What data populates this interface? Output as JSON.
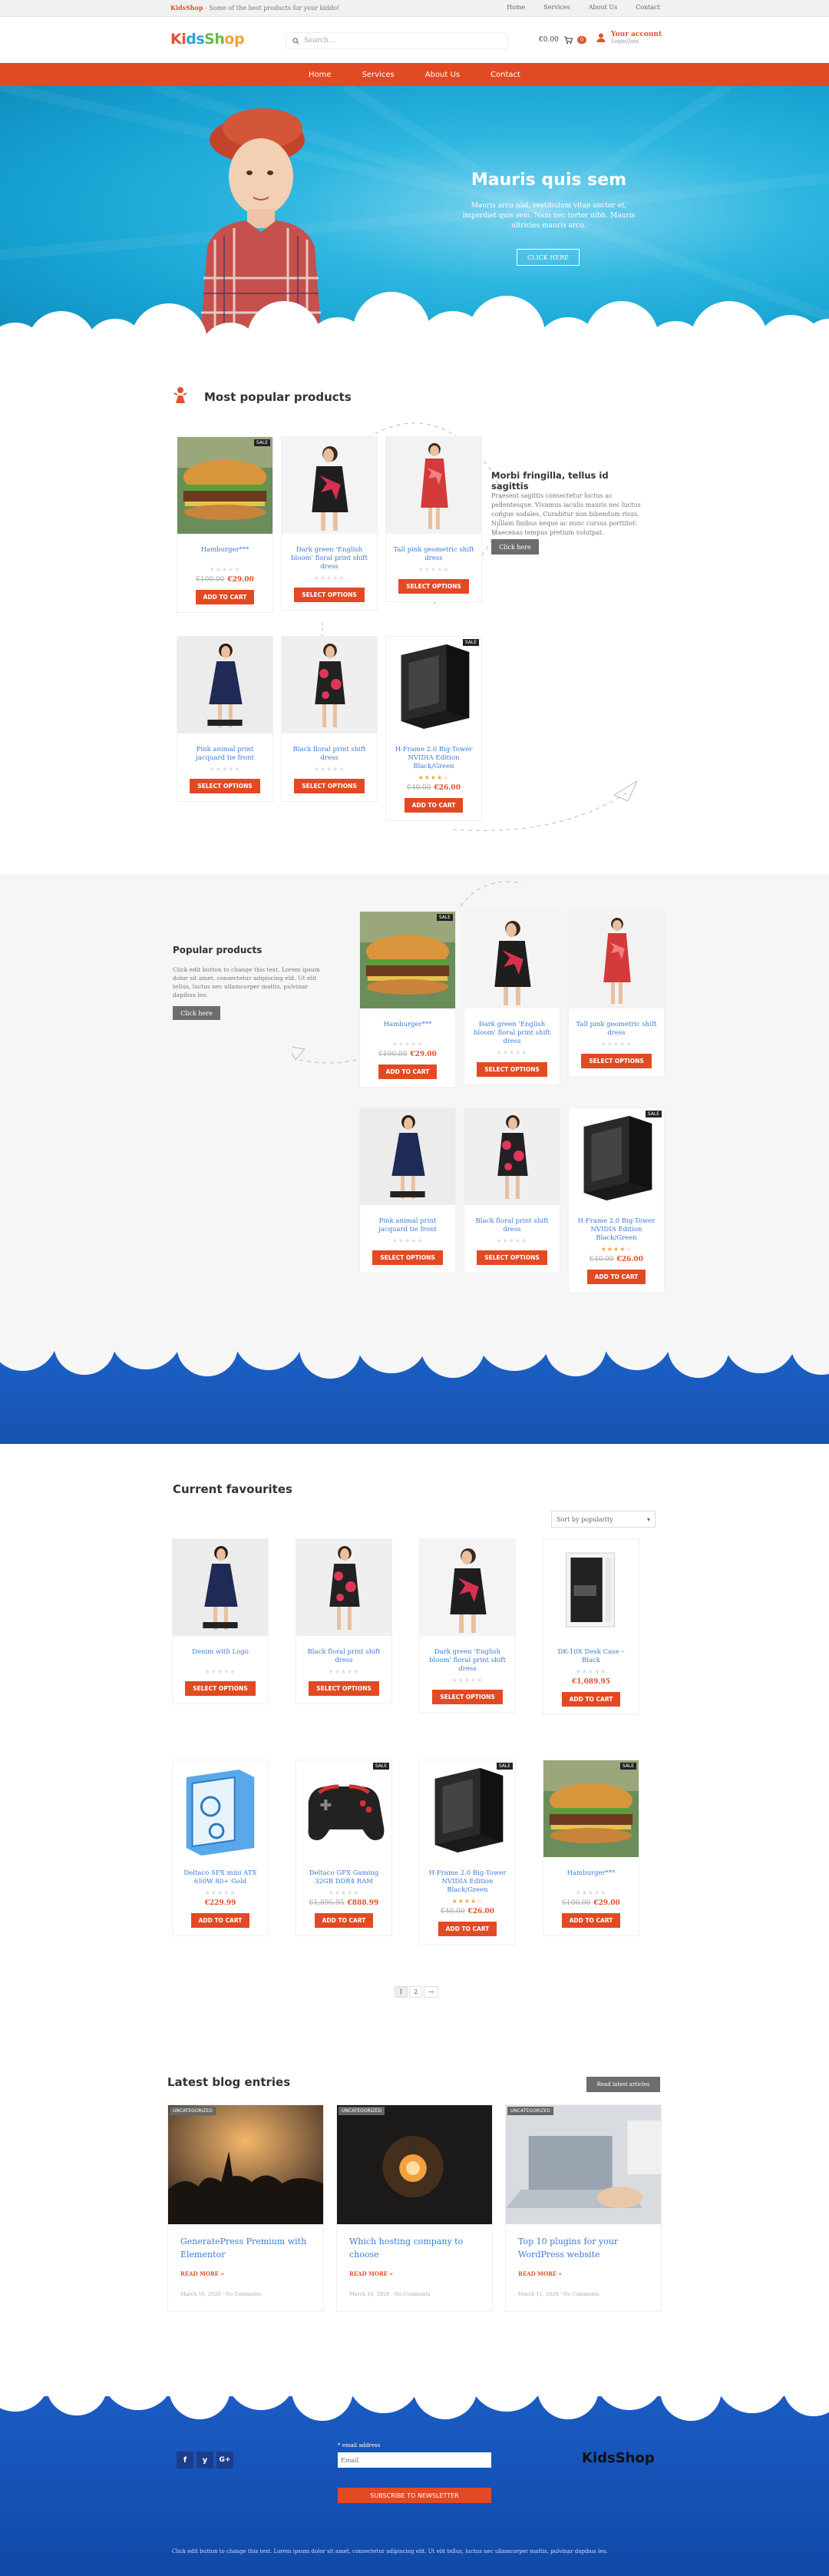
{
  "topbar": {
    "brand": "KidsShop",
    "tagline": "- Some of the best products for your kiddo!",
    "links": [
      "Home",
      "Services",
      "About Us",
      "Contact"
    ]
  },
  "header": {
    "logo": [
      "Ki",
      "ds",
      "Sh",
      "op"
    ],
    "search_placeholder": "Search...",
    "cart_total": "€0.00",
    "cart_count": "0",
    "account_label": "Your account",
    "account_sub": "Login/Join"
  },
  "nav": [
    "Home",
    "Services",
    "About Us",
    "Contact"
  ],
  "hero": {
    "title": "Mauris quis sem",
    "text": "Mauris arcu nisl, vestibulum vitae auctor et, imperdiet quis sem. Nam nec tortor nibh. Mauris ultricies mauris arcu.",
    "button": "CLICK HERE"
  },
  "popular": {
    "title": "Most popular products",
    "side_title": "Morbi fringilla, tellus id sagittis",
    "side_text": "Praesent sagittis consectetur luctus ac pellentesque. Vivamus iaculis mauris nec luctus congue sodales. Curabitur non bibendum risus. Nullam finibus neque ac nunc cursus porttitor. Maecenas tempus pretium volutpat.",
    "side_btn": "Click here",
    "products": [
      {
        "name": "Hamburger***",
        "stars": "★★★★★",
        "old": "€100.00",
        "price": "€29.00",
        "btn": "ADD TO CART",
        "sale": "SALE",
        "img": "burger"
      },
      {
        "name": "Dark green 'English bloom' floral print shift dress",
        "stars": "★★★★★",
        "btn": "SELECT OPTIONS",
        "img": "dress1"
      },
      {
        "name": "Tall pink geometric shift dress",
        "stars": "★★★★★",
        "btn": "SELECT OPTIONS",
        "img": "dress2"
      },
      {
        "name": "Pink animal print jacquard tie front",
        "stars": "★★★★★",
        "btn": "SELECT OPTIONS",
        "img": "dress3"
      },
      {
        "name": "Black floral print shift dress",
        "stars": "★★★★★",
        "btn": "SELECT OPTIONS",
        "img": "dress4"
      },
      {
        "name": "H-Frame 2.0 Big-Tower NVIDIA Edition Black/Green",
        "stars": "★★★★☆",
        "old": "€40.00",
        "price": "€26.00",
        "btn": "ADD TO CART",
        "sale": "SALE",
        "img": "pc"
      }
    ]
  },
  "popular2": {
    "title": "Popular products",
    "text": "Click edit button to change this text. Lorem ipsum dolor sit amet, consectetur adipiscing elit. Ut elit tellus, luctus nec ullamcorper mattis, pulvinar dapibus leo.",
    "btn": "Click here",
    "products": [
      {
        "name": "Hamburger***",
        "stars": "★★★★★",
        "old": "€100.00",
        "price": "€29.00",
        "btn": "ADD TO CART",
        "sale": "SALE",
        "img": "burger"
      },
      {
        "name": "Dark green 'English bloom' floral print shift dress",
        "stars": "★★★★★",
        "btn": "SELECT OPTIONS",
        "img": "dress1"
      },
      {
        "name": "Tall pink geometric shift dress",
        "stars": "★★★★★",
        "btn": "SELECT OPTIONS",
        "img": "dress2"
      },
      {
        "name": "Pink animal print jacquard tie front",
        "stars": "★★★★★",
        "btn": "SELECT OPTIONS",
        "img": "dress3"
      },
      {
        "name": "Black floral print shift dress",
        "stars": "★★★★★",
        "btn": "SELECT OPTIONS",
        "img": "dress4"
      },
      {
        "name": "H-Frame 2.0 Big-Tower NVIDIA Edition Black/Green",
        "stars": "★★★★☆",
        "old": "€40.00",
        "price": "€26.00",
        "btn": "ADD TO CART",
        "sale": "SALE",
        "img": "pc"
      }
    ]
  },
  "favourites": {
    "title": "Current favourites",
    "sort": "Sort by popularity",
    "products": [
      {
        "name": "Denim with Logo",
        "stars": "★★★★★",
        "btn": "SELECT OPTIONS",
        "img": "dress3"
      },
      {
        "name": "Black floral print shift dress",
        "stars": "★★★★★",
        "btn": "SELECT OPTIONS",
        "img": "dress4"
      },
      {
        "name": "Dark green 'English bloom' floral print shift dress",
        "stars": "★★★★★",
        "btn": "SELECT OPTIONS",
        "img": "dress1"
      },
      {
        "name": "DK-10X Desk Case – Black",
        "stars": "★★★★★",
        "price": "€1,089.95",
        "btn": "ADD TO CART",
        "img": "pcwhite"
      },
      {
        "name": "Deltaco SFX mini ATX 650W 80+ Gold",
        "stars": "★★★★★",
        "price": "€229.99",
        "btn": "ADD TO CART",
        "img": "pcblue"
      },
      {
        "name": "Deltaco GFX Gaming 32GB DDR4 RAM",
        "stars": "★★★★★",
        "old": "€1,895.95",
        "price": "€888.99",
        "btn": "ADD TO CART",
        "sale": "SALE",
        "img": "pad"
      },
      {
        "name": "H-Frame 2.0 Big-Tower NVIDIA Edition Black/Green",
        "stars": "★★★★☆",
        "old": "€40.00",
        "price": "€26.00",
        "btn": "ADD TO CART",
        "sale": "SALE",
        "img": "pc"
      },
      {
        "name": "Hamburger***",
        "stars": "★★★★★",
        "old": "€100.00",
        "price": "€29.00",
        "btn": "ADD TO CART",
        "sale": "SALE",
        "img": "burger"
      }
    ],
    "pages": [
      "1",
      "2",
      "→"
    ]
  },
  "blog": {
    "title": "Latest blog entries",
    "btn": "Read latest articles",
    "posts": [
      {
        "tag": "UNCATEGORIZED",
        "title": "GeneratePress Premium with Elementor",
        "more": "READ MORE »",
        "meta": "March 10, 2020 · No Comments",
        "img": "concert"
      },
      {
        "tag": "UNCATEGORIZED",
        "title": "Which hosting company to choose",
        "more": "READ MORE »",
        "meta": "March 10, 2020 · No Comments",
        "img": "bulb"
      },
      {
        "tag": "UNCATEGORIZED",
        "title": "Top 10 plugins for your WordPress website",
        "more": "READ MORE »",
        "meta": "March 11, 2020 · No Comments",
        "img": "laptop"
      }
    ]
  },
  "footer": {
    "social": [
      "f",
      "y",
      "G+"
    ],
    "email_label": "* email address",
    "email_placeholder": "Email",
    "subscribe": "SUBSCRIBE TO NEWSLETTER",
    "logo": "KidsShop",
    "bottom_text": "Click edit button to change this text. Lorem ipsum dolor sit amet, consectetur adipiscing elit. Ut elit tellus, luctus nec ullamcorper mattis, pulvinar dapibus leo."
  },
  "colors": {
    "accent": "#e24a24",
    "link": "#3a7bd5",
    "sky": "#2cb6e0",
    "footer": "#1651b0"
  }
}
